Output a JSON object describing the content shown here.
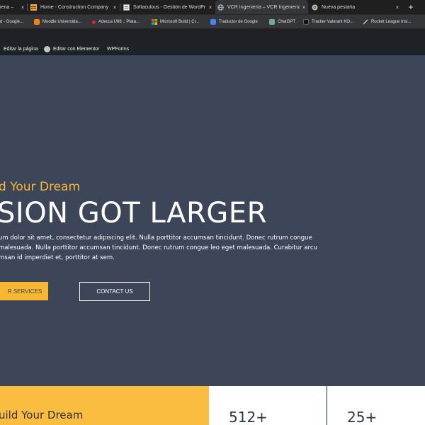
{
  "browser": {
    "tabs": [
      {
        "label": "ieria –",
        "favicon": "globe-icon"
      },
      {
        "label": "Home - Construction Company",
        "favicon": "brand-icon"
      },
      {
        "label": "Softaculous - Gestión de WordPr",
        "favicon": "page-icon"
      },
      {
        "label": "VCR Ingeniería – VCR Ingeniería",
        "favicon": "globe-icon",
        "active": true
      },
      {
        "label": "Nueva pestaña",
        "favicon": "chrome-icon"
      }
    ],
    "close_glyph": "×",
    "new_tab_glyph": "+"
  },
  "bookmarks": [
    {
      "label": "d - Google...",
      "color": "#4285f4"
    },
    {
      "label": "Moodle Universida...",
      "color": "#f98012"
    },
    {
      "label": "Adecca U88 .: Plata...",
      "color": "#d32f2f"
    },
    {
      "label": "Microsoft Build | Cl...",
      "color": "#f25022"
    },
    {
      "label": "Traductor de Google",
      "color": "#4285f4"
    },
    {
      "label": "ChatGPT",
      "color": "#74aa9c"
    },
    {
      "label": "Tracker Valorant KO...",
      "color": "#222222"
    },
    {
      "label": "Rocket League Insi...",
      "color": "#888888"
    }
  ],
  "adminbar": {
    "edit_page": "Editar la página",
    "edit_elementor": "Editar con Elementor",
    "wpforms": "WPForms"
  },
  "hero": {
    "subtitle": "d Your Dream",
    "title": "SION GOT LARGER",
    "text_lines": [
      "um dolor sit amet, consectetur adipiscing elit. Nulla porttitor accumsan tincidunt. Donec rutrum congue",
      "malesuada. Nulla porttitor accumsan tincidunt. Donec rutrum congue leo eget malesuada. Curabitur arcu",
      "msan id imperdiet et, porttitor at sem."
    ],
    "btn_services": "R SERVICES",
    "btn_contact": "CONTACT US"
  },
  "cards": {
    "yellow_title": "uild Your Dream",
    "stat1": "512+",
    "stat2": "25+"
  },
  "colors": {
    "accent": "#f7b733",
    "hero_bg": "#3d4658"
  }
}
